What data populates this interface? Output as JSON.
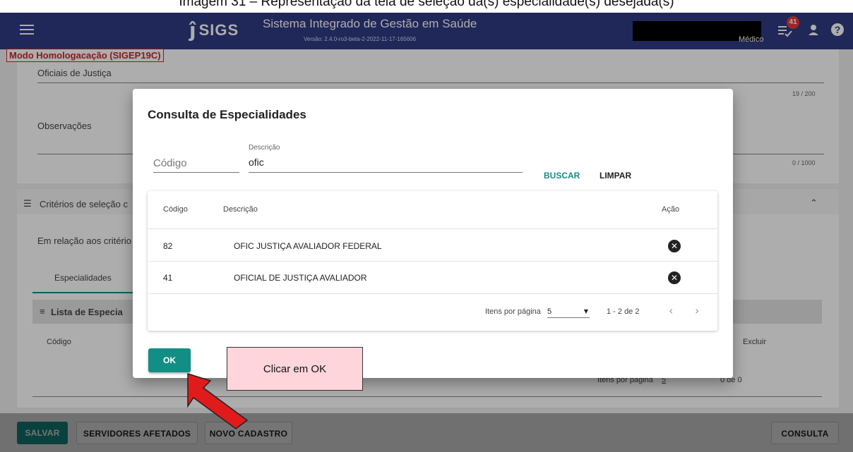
{
  "caption": "Imagem 31 – Representação da tela de seleção da(s) especialidade(s) desejada(s)",
  "header": {
    "logo_text": "SIGS",
    "system_name": "Sistema Integrado de Gestão em Saúde",
    "version": "Versão: 2.4.0-ro3-beta-2-2022-11-17-165606",
    "role": "Médico",
    "notification_count": "41"
  },
  "env_badge": "Modo Homologacação (SIGEP19C)",
  "background_form": {
    "name_value": "Oficiais de Justiça",
    "name_counter": "19 / 200",
    "obs_label": "Observações",
    "obs_counter": "0 / 1000",
    "criteria_title": "Critérios de seleção c",
    "criteria_text": "Em relação aos critério",
    "tab_specialties": "Especialidades",
    "list_title": "Lista de Especia",
    "col_code": "Código",
    "col_delete": "Excluir",
    "pager_label": "Itens por página",
    "pager_size": "5",
    "pager_range": "0 de 0"
  },
  "dialog": {
    "title": "Consulta de Especialidades",
    "code_placeholder": "Código",
    "desc_label": "Descrição",
    "desc_value": "ofic",
    "search_button": "BUSCAR",
    "clear_button": "LIMPAR",
    "table": {
      "headers": {
        "code": "Código",
        "description": "Descrição",
        "action": "Ação"
      },
      "rows": [
        {
          "code": "82",
          "description": "OFIC JUSTIÇA AVALIADOR FEDERAL"
        },
        {
          "code": "41",
          "description": "OFICIAL DE JUSTIÇA AVALIADOR"
        }
      ]
    },
    "pager_label": "Itens por página",
    "pager_size": "5",
    "pager_range": "1 - 2 de 2",
    "ok_button": "OK"
  },
  "callout_text": "Clicar em OK",
  "actions": {
    "save": "SALVAR",
    "affected": "SERVIDORES AFETADOS",
    "new_record": "NOVO CADASTRO",
    "query": "CONSULTA"
  },
  "colors": {
    "topbar": "#303a84",
    "primary": "#138e85",
    "badge": "#e53935",
    "callout_fill": "#ffd5dc",
    "arrow": "#e01b1b"
  }
}
